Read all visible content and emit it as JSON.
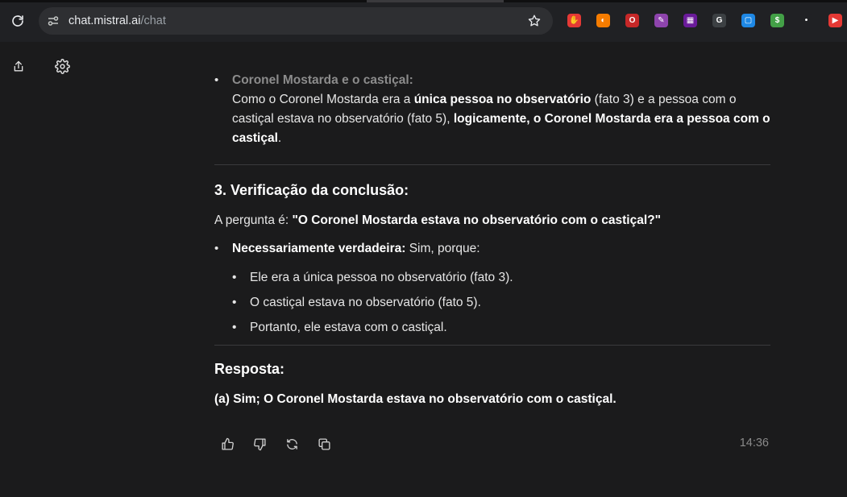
{
  "browser": {
    "url_host": "chat.mistral.ai",
    "url_path": "/chat",
    "extensions": [
      {
        "name": "ublock-icon",
        "color": "#e53935",
        "glyph": "✋"
      },
      {
        "name": "extension-orange-icon",
        "color": "#f57c00",
        "glyph": "◐"
      },
      {
        "name": "extension-red-o-icon",
        "color": "#c62828",
        "glyph": "O"
      },
      {
        "name": "extension-purple-icon",
        "color": "#8e44ad",
        "glyph": "✎"
      },
      {
        "name": "extension-grid-icon",
        "color": "#6a1b9a",
        "glyph": "▦"
      },
      {
        "name": "google-icon",
        "color": "#3c4043",
        "glyph": "G"
      },
      {
        "name": "extension-screen-icon",
        "color": "#1e88e5",
        "glyph": "▢"
      },
      {
        "name": "extension-green-dollar-icon",
        "color": "#43a047",
        "glyph": "$"
      },
      {
        "name": "extension-dot-icon",
        "color": "#202124",
        "glyph": "•"
      },
      {
        "name": "extension-youtube-icon",
        "color": "#e53935",
        "glyph": "▶"
      }
    ]
  },
  "content": {
    "item1_title": "Coronel Mostarda e o castiçal:",
    "item1_p1": "Como o Coronel Mostarda era a ",
    "item1_b1": "única pessoa no observatório",
    "item1_p2": " (fato 3) e a pessoa com o castiçal estava no observatório (fato 5), ",
    "item1_b2": "logicamente, o Coronel Mostarda era a pessoa com o castiçal",
    "item1_p3": ".",
    "section3_title": "3. Verificação da conclusão:",
    "question_prefix": "A pergunta é: ",
    "question_bold": "\"O Coronel Mostarda estava no observatório com o castiçal?\"",
    "nec_label": "Necessariamente verdadeira:",
    "nec_text": " Sim, porque:",
    "reasons": [
      "Ele era a única pessoa no observatório (fato 3).",
      "O castiçal estava no observatório (fato 5).",
      "Portanto, ele estava com o castiçal."
    ],
    "answer_title": "Resposta:",
    "answer_text": "(a) Sim; O Coronel Mostarda estava no observatório com o castiçal."
  },
  "message_meta": {
    "time": "14:36"
  }
}
